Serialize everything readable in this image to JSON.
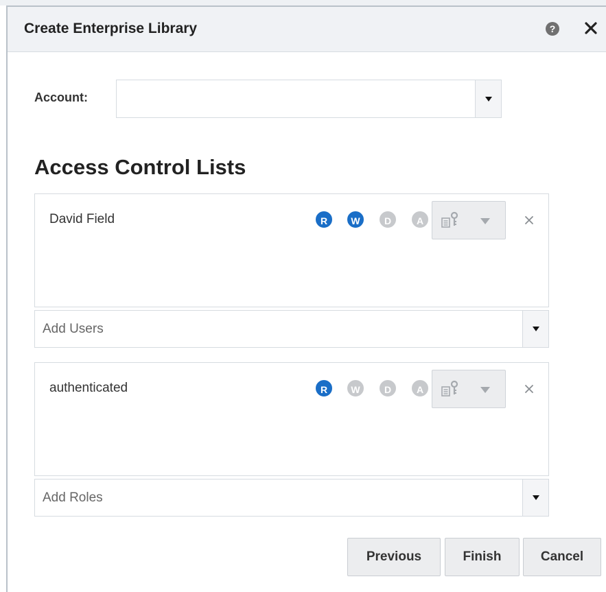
{
  "dialog": {
    "title": "Create Enterprise Library",
    "help_icon_glyph": "?",
    "help_icon": "help-circle-icon",
    "close_icon": "close-icon"
  },
  "account": {
    "label": "Account:",
    "value": ""
  },
  "acl": {
    "title": "Access Control Lists",
    "users": {
      "entries": [
        {
          "name": "David Field",
          "permissions": [
            {
              "letter": "R",
              "enabled": true
            },
            {
              "letter": "W",
              "enabled": true
            },
            {
              "letter": "D",
              "enabled": false
            },
            {
              "letter": "A",
              "enabled": false
            }
          ]
        }
      ],
      "add_placeholder": "Add Users"
    },
    "roles": {
      "entries": [
        {
          "name": "authenticated",
          "permissions": [
            {
              "letter": "R",
              "enabled": true
            },
            {
              "letter": "W",
              "enabled": false
            },
            {
              "letter": "D",
              "enabled": false
            },
            {
              "letter": "A",
              "enabled": false
            }
          ]
        }
      ],
      "add_placeholder": "Add Roles"
    }
  },
  "footer": {
    "previous_label": "Previous",
    "finish_label": "Finish",
    "cancel_label": "Cancel"
  },
  "colors": {
    "permission_on": "#1a6ec7",
    "permission_off": "#c7c9cc",
    "titlebar_bg": "#f0f2f5",
    "border": "#d6dbe0"
  }
}
